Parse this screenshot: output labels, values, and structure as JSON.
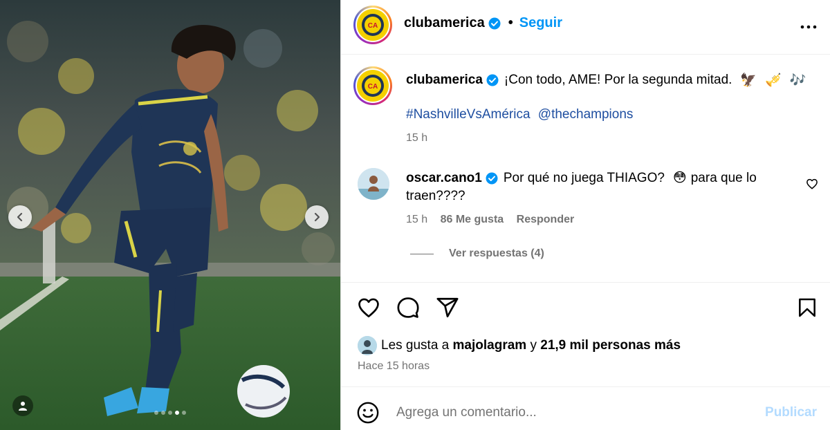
{
  "post": {
    "username": "clubamerica",
    "header_separator": "•",
    "follow_label": "Seguir",
    "caption_text": "¡Con todo, AME! Por la segunda mitad.",
    "caption_emojis": [
      "🦅",
      "🎺",
      "🎶"
    ],
    "hashtag": "#NashvilleVsAmérica",
    "mention": "@thechampions",
    "caption_time": "15 h"
  },
  "comment": {
    "username": "oscar.cano1",
    "text_part1": "Por qué no juega THIAGO?",
    "emoji": "😳",
    "text_part2": "para que lo",
    "text_line2": "traen????",
    "time": "15 h",
    "likes": "86 Me gusta",
    "reply_label": "Responder",
    "view_replies": "Ver respuestas (4)"
  },
  "likes": {
    "prefix": "Les gusta a",
    "user": "majolagram",
    "connector": "y",
    "others": "21,9 mil personas más"
  },
  "date_label": "Hace 15 horas",
  "composer": {
    "placeholder": "Agrega un comentario...",
    "publish_label": "Publicar"
  },
  "carousel": {
    "dot_count": 5,
    "active_index": 3
  },
  "colors": {
    "link_blue": "#0095f6",
    "hashtag_blue": "#1e4ea0",
    "muted": "#737373",
    "publish_disabled": "#b3dbff",
    "club_yellow": "#f4d000",
    "jersey_navy": "#1f3556"
  }
}
